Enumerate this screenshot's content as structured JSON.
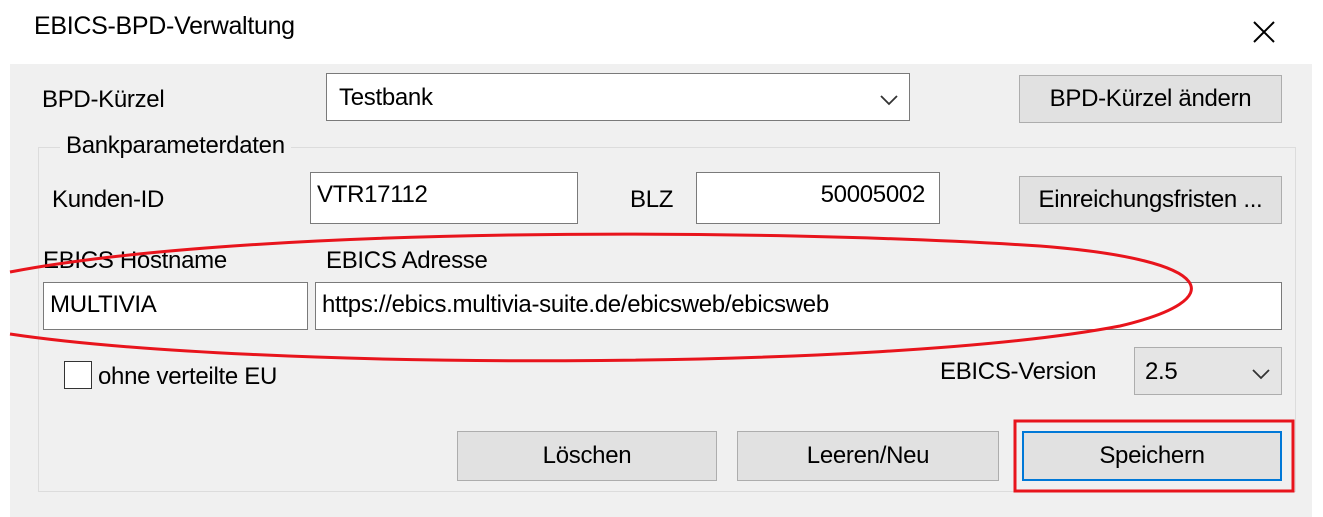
{
  "window": {
    "title": "EBICS-BPD-Verwaltung"
  },
  "bpd": {
    "label": "BPD-Kürzel",
    "selected": "Testbank",
    "change_button": "BPD-Kürzel ändern"
  },
  "group": {
    "legend": "Bankparameterdaten",
    "customer_id_label": "Kunden-ID",
    "customer_id_value": "VTR17112",
    "blz_label": "BLZ",
    "blz_value": "50005002",
    "deadlines_button": "Einreichungsfristen ...",
    "hostname_label": "EBICS Hostname",
    "hostname_value": "MULTIVIA",
    "address_label": "EBICS Adresse",
    "address_value": "https://ebics.multivia-suite.de/ebicsweb/ebicsweb",
    "checkbox_label": "ohne verteilte EU",
    "checkbox_checked": false,
    "version_label": "EBICS-Version",
    "version_selected": "2.5"
  },
  "actions": {
    "delete": "Löschen",
    "clear_new": "Leeren/Neu",
    "save": "Speichern"
  },
  "colors": {
    "annotation_red": "#e8141c",
    "focus_blue": "#0078d7"
  }
}
